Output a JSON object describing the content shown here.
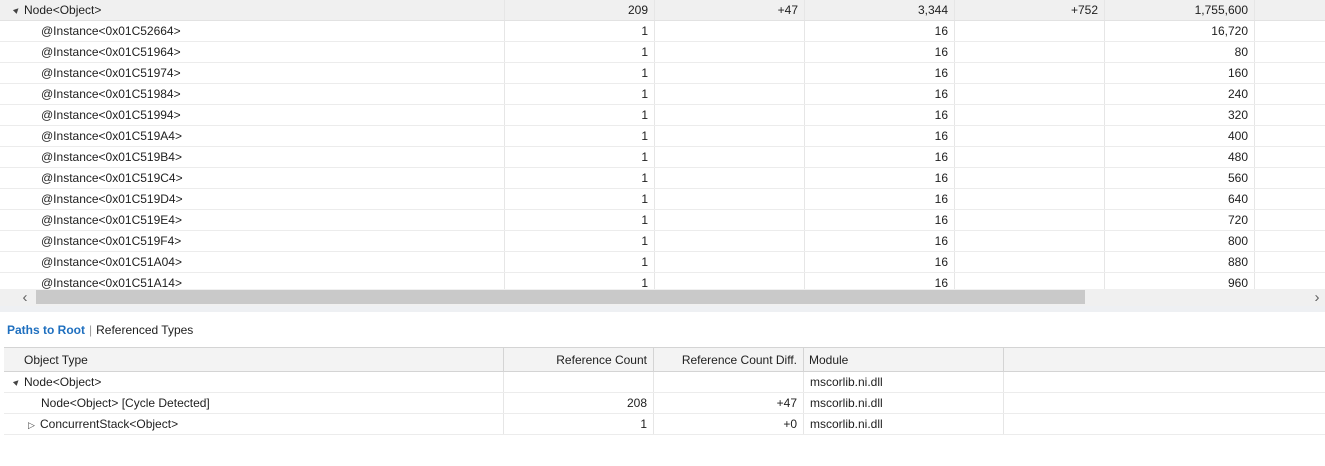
{
  "top_table": {
    "group": {
      "label": "Node<Object>",
      "count": "209",
      "count_diff": "+47",
      "size": "3,344",
      "size_diff": "+752",
      "inclusive_size": "1,755,600"
    },
    "rows": [
      {
        "label": "@Instance<0x01C52664>",
        "count": "1",
        "size": "16",
        "inclusive_size": "16,720"
      },
      {
        "label": "@Instance<0x01C51964>",
        "count": "1",
        "size": "16",
        "inclusive_size": "80"
      },
      {
        "label": "@Instance<0x01C51974>",
        "count": "1",
        "size": "16",
        "inclusive_size": "160"
      },
      {
        "label": "@Instance<0x01C51984>",
        "count": "1",
        "size": "16",
        "inclusive_size": "240"
      },
      {
        "label": "@Instance<0x01C51994>",
        "count": "1",
        "size": "16",
        "inclusive_size": "320"
      },
      {
        "label": "@Instance<0x01C519A4>",
        "count": "1",
        "size": "16",
        "inclusive_size": "400"
      },
      {
        "label": "@Instance<0x01C519B4>",
        "count": "1",
        "size": "16",
        "inclusive_size": "480"
      },
      {
        "label": "@Instance<0x01C519C4>",
        "count": "1",
        "size": "16",
        "inclusive_size": "560"
      },
      {
        "label": "@Instance<0x01C519D4>",
        "count": "1",
        "size": "16",
        "inclusive_size": "640"
      },
      {
        "label": "@Instance<0x01C519E4>",
        "count": "1",
        "size": "16",
        "inclusive_size": "720"
      },
      {
        "label": "@Instance<0x01C519F4>",
        "count": "1",
        "size": "16",
        "inclusive_size": "800"
      },
      {
        "label": "@Instance<0x01C51A04>",
        "count": "1",
        "size": "16",
        "inclusive_size": "880"
      },
      {
        "label": "@Instance<0x01C51A14>",
        "count": "1",
        "size": "16",
        "inclusive_size": "960"
      }
    ]
  },
  "tabs": {
    "active": "Paths to Root",
    "separator": "|",
    "other": "Referenced Types"
  },
  "bottom_table": {
    "headers": {
      "object_type": "Object Type",
      "reference_count": "Reference Count",
      "reference_count_diff": "Reference Count Diff.",
      "module": "Module"
    },
    "rows": [
      {
        "label": "Node<Object>",
        "ref_count": "",
        "ref_diff": "",
        "module": "mscorlib.ni.dll"
      },
      {
        "label": "Node<Object> [Cycle Detected]",
        "ref_count": "208",
        "ref_diff": "+47",
        "module": "mscorlib.ni.dll"
      },
      {
        "label": "ConcurrentStack<Object>",
        "ref_count": "1",
        "ref_diff": "+0",
        "module": "mscorlib.ni.dll"
      }
    ]
  },
  "icons": {
    "expanded": "▲",
    "collapsed": "▷",
    "scroll_left": "‹",
    "scroll_right": "›"
  },
  "colors": {
    "accent": "#1e6fbf",
    "group_bg": "#f0f0f0",
    "header_bg": "#f3f3f3"
  }
}
